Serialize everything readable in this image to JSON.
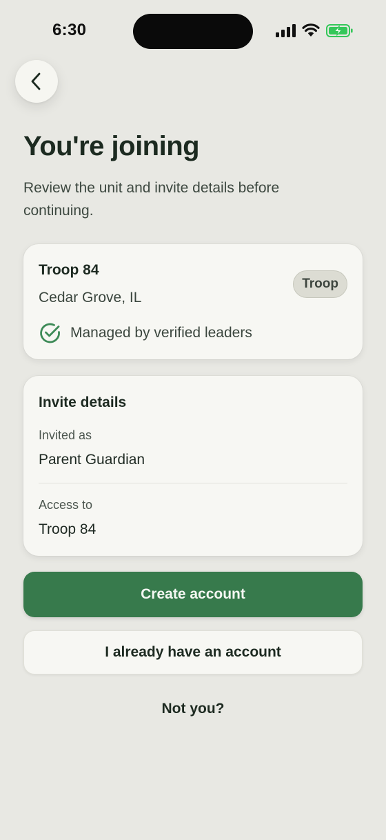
{
  "status_bar": {
    "time": "6:30",
    "icons": [
      "cellular-signal-icon",
      "wifi-icon",
      "battery-charging-icon"
    ],
    "battery_color": "#34c759"
  },
  "navigation": {
    "back_icon": "chevron-left-icon"
  },
  "header": {
    "title": "You're joining",
    "subtitle": "Review the unit and invite details before continuing."
  },
  "unit_card": {
    "name": "Troop 84",
    "location": "Cedar Grove, IL",
    "badge": "Troop",
    "verified_icon": "check-circle-icon",
    "verified_text": "Managed by verified leaders"
  },
  "invite_card": {
    "heading": "Invite details",
    "fields": [
      {
        "label": "Invited as",
        "value": "Parent Guardian"
      },
      {
        "label": "Access to",
        "value": "Troop 84"
      }
    ]
  },
  "actions": {
    "primary_label": "Create account",
    "secondary_label": "I already have an account",
    "link_label": "Not you?"
  },
  "colors": {
    "background": "#e8e8e3",
    "card": "#f7f7f3",
    "accent": "#377a4c",
    "heading_text": "#1c2a20"
  }
}
